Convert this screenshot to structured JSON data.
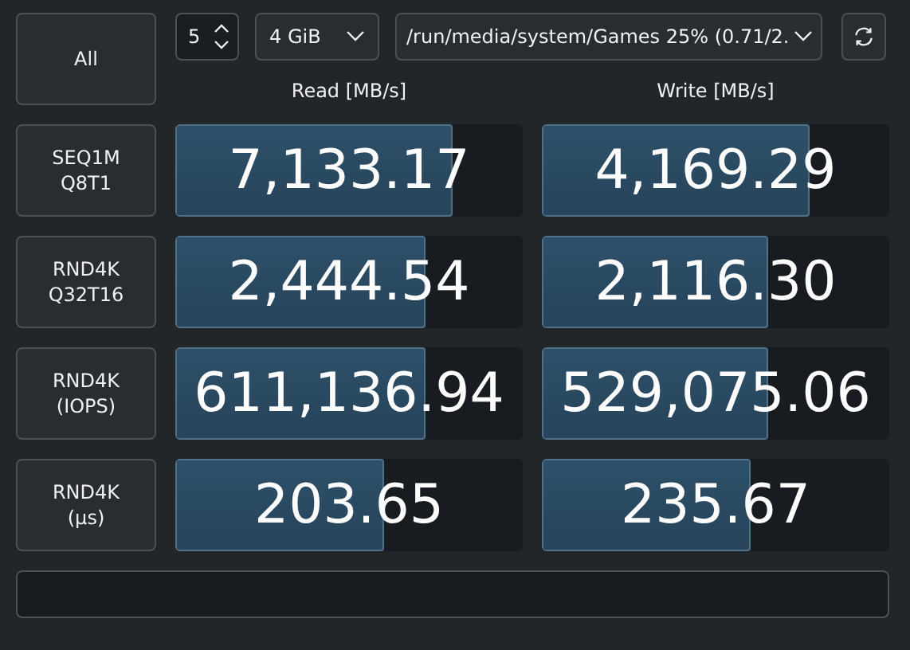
{
  "all_button": "All",
  "runs": {
    "value": "5"
  },
  "size": {
    "value": "4 GiB"
  },
  "target": {
    "value": "/run/media/system/Games 25% (0.71/2."
  },
  "headers": [
    "Read [MB/s]",
    "Write [MB/s]"
  ],
  "tests": [
    {
      "label": "SEQ1M\nQ8T1",
      "read": {
        "value": "7,133.17",
        "level": 0.8
      },
      "write": {
        "value": "4,169.29",
        "level": 0.77
      }
    },
    {
      "label": "RND4K\nQ32T16",
      "read": {
        "value": "2,444.54",
        "level": 0.72
      },
      "write": {
        "value": "2,116.30",
        "level": 0.65
      }
    },
    {
      "label": "RND4K\n(IOPS)",
      "read": {
        "value": "611,136.94",
        "level": 0.72
      },
      "write": {
        "value": "529,075.06",
        "level": 0.65
      }
    },
    {
      "label": "RND4K\n(µs)",
      "read": {
        "value": "203.65",
        "level": 0.6
      },
      "write": {
        "value": "235.67",
        "level": 0.6
      }
    }
  ],
  "progress": {
    "level": 0
  }
}
